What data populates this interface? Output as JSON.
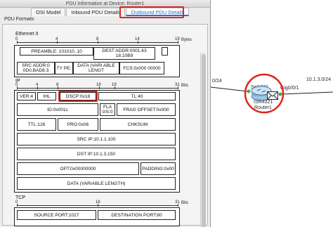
{
  "window": {
    "title": "PDU Information at Device: Router1"
  },
  "tabs": [
    {
      "label": "OSI Model",
      "active": false
    },
    {
      "label": "Inbound PDU Details",
      "active": false
    },
    {
      "label": "Outbound PDU Details",
      "active": true
    }
  ],
  "pdu_formats_label": "PDU Formats",
  "ethernet": {
    "title": "Ethernet II",
    "ruler": [
      "0",
      "4",
      "8",
      "14",
      "19"
    ],
    "unit": "Bytes",
    "preamble": "PREAMBLE: 101010..10",
    "dest_addr": "DEST ADDR:0001.63 18.10B9",
    "src_addr": "SRC ADDR:0 0D0.BAD8.3",
    "type": "TY PE:",
    "data": "DATA (VARI ABLE LENGT",
    "fcs": "FCS:0x000 00000"
  },
  "ip": {
    "title": "IP",
    "ruler": [
      "0",
      "4",
      "8",
      "16",
      "19",
      "31"
    ],
    "unit": "Bits",
    "ver": "VER:4",
    "ihl": "IHL",
    "dscp": "DSCP:0x18",
    "tl": "TL:40",
    "id": "ID:0x001c",
    "flags": "FLA GS:0",
    "frag_offset": "FRAG OFFSET:0x000",
    "ttl": "TTL:126",
    "pro": "PRO:0x06",
    "chksum": "CHKSUM",
    "src_ip": "SRC IP:10.1.1.100",
    "dst_ip": "DST IP:10.1.3.150",
    "opt": "OPT:0x00000000",
    "padding": "PADDING:0x00",
    "data": "DATA (VARIABLE LENGTH)"
  },
  "tcp": {
    "title": "TCP",
    "ruler": [
      "0",
      "16",
      "31"
    ],
    "unit": "Bits",
    "source_port": "SOURCE PORT:1027",
    "destination_port": "DESTINATION PORT:80"
  },
  "topology": {
    "left_network": "0/24",
    "right_network": "10.1.3.0/24",
    "port_left": "Se0/2/0",
    "port_right": "Gig0/0/1",
    "router_model": "ISR4321",
    "router_name": "Router1"
  },
  "colors": {
    "highlight": "#e0241b",
    "accent": "#2b6fd6",
    "link": "#1f1f1f"
  }
}
